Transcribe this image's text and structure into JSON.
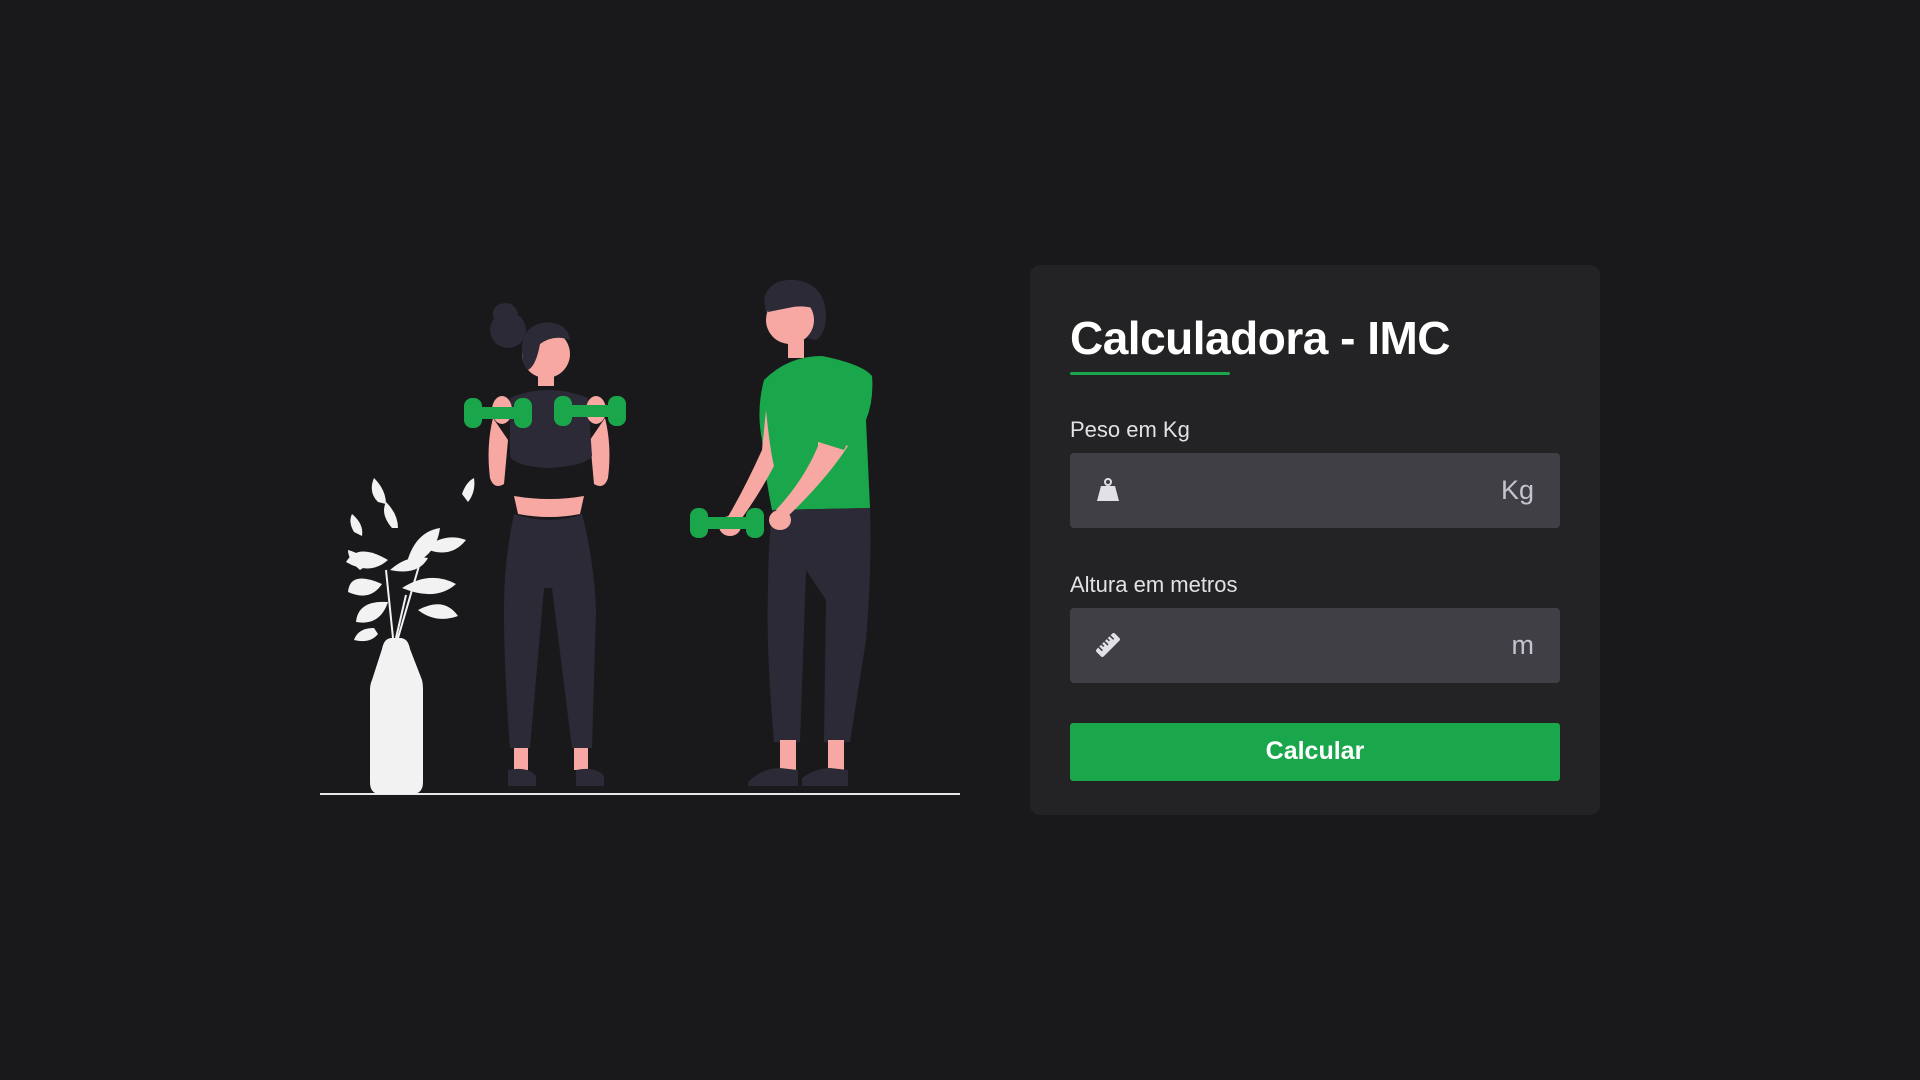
{
  "calculator": {
    "title": "Calculadora - IMC",
    "weight": {
      "label": "Peso em Kg",
      "value": "",
      "placeholder": "",
      "unit": "Kg",
      "icon": "weight-icon"
    },
    "height": {
      "label": "Altura em metros",
      "value": "",
      "placeholder": "",
      "unit": "m",
      "icon": "ruler-icon"
    },
    "button_label": "Calcular"
  },
  "colors": {
    "background": "#19191b",
    "card": "#232325",
    "input": "#3f3f45",
    "accent": "#1aa64b",
    "skin": "#f7a8a2",
    "clothing_dark": "#2c2a36",
    "plant": "#f2f2f2"
  }
}
